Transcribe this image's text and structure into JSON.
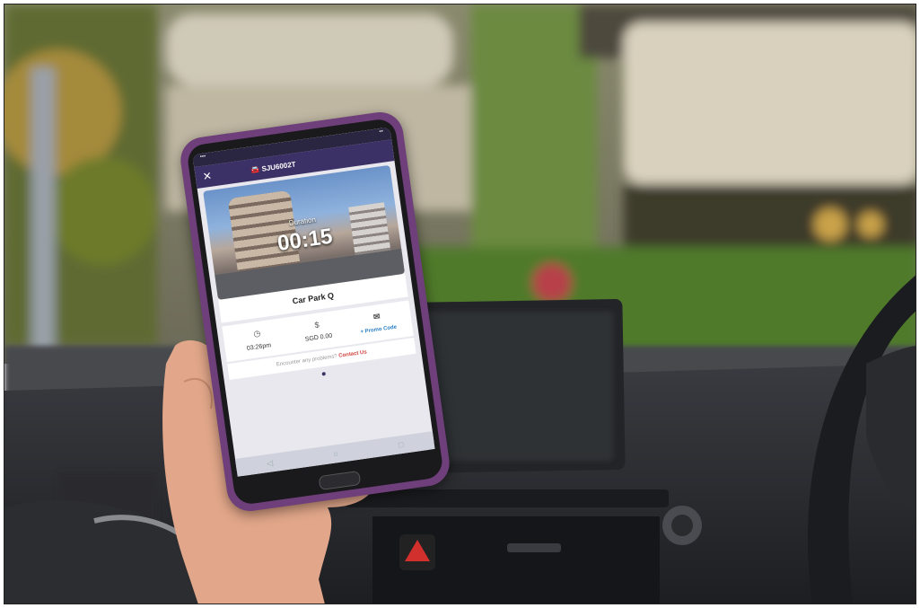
{
  "phone": {
    "status_time": "",
    "vehicle_plate": "SJU6002T",
    "duration_label": "Duration",
    "duration_value": "00:15",
    "car_park_name": "Car Park Q",
    "start_time": "03:26pm",
    "charge": "SGD 0.00",
    "payment_label": "+ Promo Code",
    "help_text": "Encounter any problems?",
    "contact_label": "Contact Us",
    "icons": {
      "close": "close-icon",
      "car": "car-icon",
      "clock": "clock-icon",
      "money": "money-icon",
      "ticket": "ticket-icon"
    }
  },
  "colors": {
    "case": "#6e3f7a",
    "app_bar": "#3c3166",
    "contact_link": "#d0453f",
    "promo_link": "#2a7fc5"
  }
}
